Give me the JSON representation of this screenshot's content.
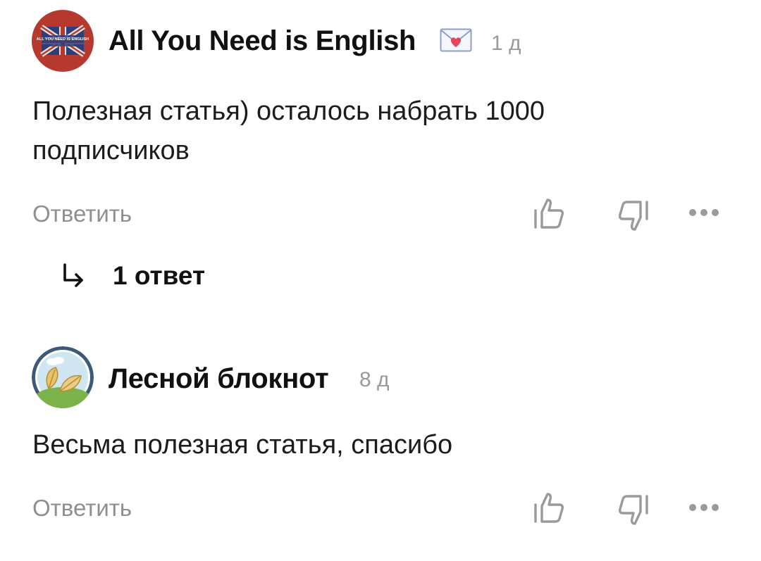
{
  "comments": [
    {
      "author": "All You Need is English",
      "author_badge": "love-letter-emoji",
      "time": "1 д",
      "avatar_text": "ALL YOU NEED IS ENGLISH",
      "text_line1": "Полезная статья) осталось набрать 1000",
      "text_line2": "подписчиков",
      "reply_label": "Ответить",
      "replies_label": "1 ответ"
    },
    {
      "author": "Лесной блокнот",
      "time": "8 д",
      "text_line1": "Весьма полезная статья, спасибо",
      "reply_label": "Ответить"
    }
  ],
  "icons": {
    "like": "thumbs-up-icon",
    "dislike": "thumbs-down-icon",
    "more": "more-dots-icon",
    "replies_arrow": "reply-arrow-icon"
  },
  "colors": {
    "secondary_text": "#8f8f8f",
    "icon_gray": "#9a9a9a",
    "avatar1_bg": "#b23a30",
    "avatar2_border": "#3c5a78"
  }
}
